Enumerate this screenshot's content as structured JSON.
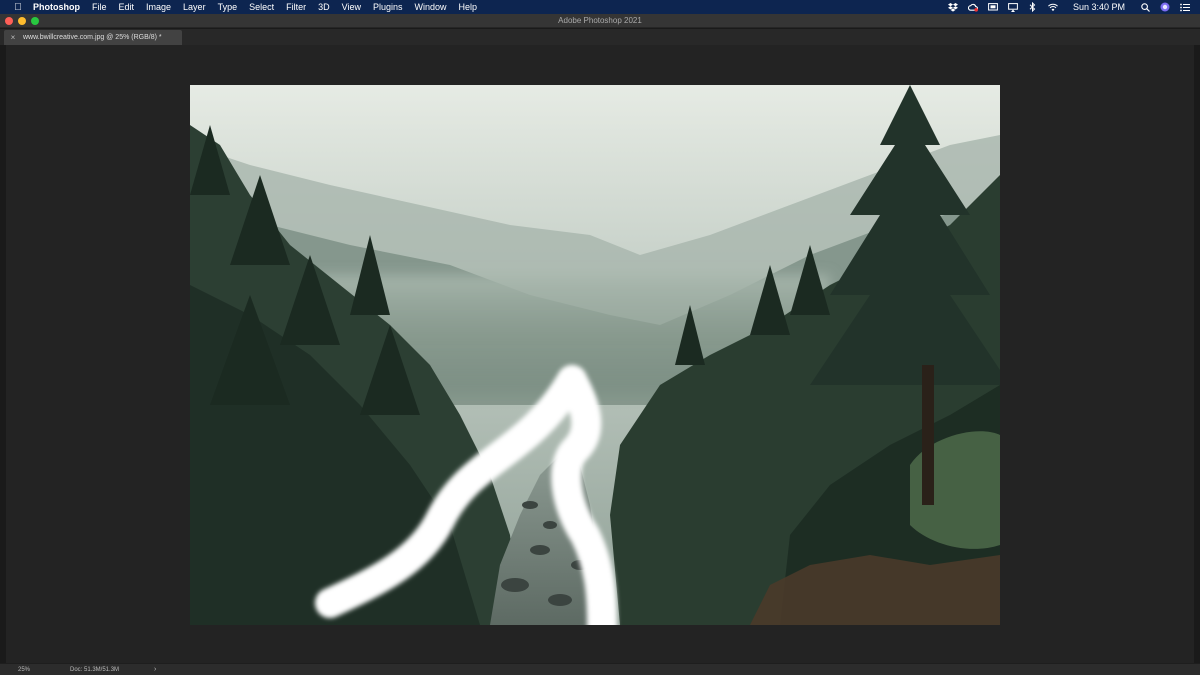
{
  "menubar": {
    "app_name": "Photoshop",
    "items": [
      "File",
      "Edit",
      "Image",
      "Layer",
      "Type",
      "Select",
      "Filter",
      "3D",
      "View",
      "Plugins",
      "Window",
      "Help"
    ],
    "clock": "Sun 3:40 PM",
    "status_icons": [
      "dropbox-icon",
      "creative-cloud-icon",
      "screen-share-icon",
      "airplay-icon",
      "bluetooth-icon",
      "wifi-icon",
      "search-icon",
      "siri-icon",
      "notification-center-icon"
    ]
  },
  "window": {
    "title": "Adobe Photoshop 2021"
  },
  "document_tab": {
    "label": "www.bwillcreative.com.jpg @ 25% (RGB/8) *"
  },
  "statusbar": {
    "zoom": "25%",
    "doc_size": "Doc: 51.3M/51.3M"
  },
  "colors": {
    "menubar_bg": "#0d2550",
    "workspace_bg": "#232323",
    "brush_stroke": "#ffffff"
  }
}
